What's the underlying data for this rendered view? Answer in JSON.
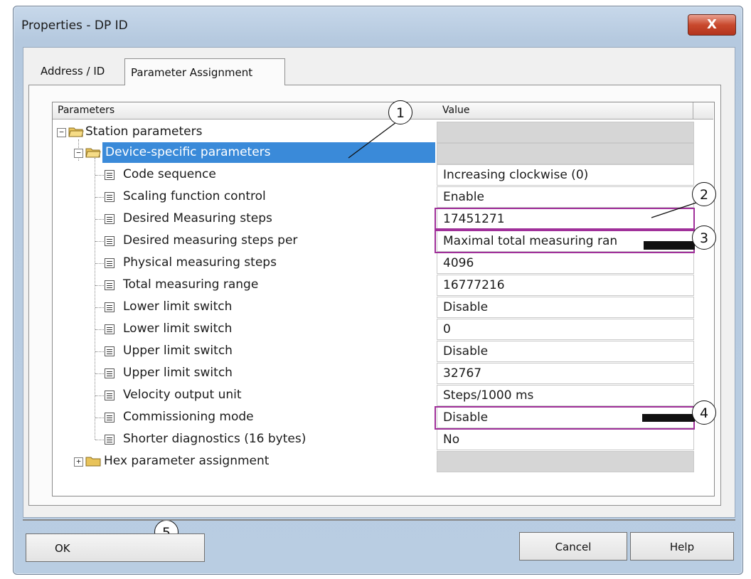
{
  "window": {
    "title": "Properties - DP ID",
    "close_glyph": "X"
  },
  "tabs": [
    {
      "label": "Address / ID"
    },
    {
      "label": "Parameter Assignment"
    }
  ],
  "grid": {
    "headers": {
      "parameters": "Parameters",
      "value": "Value"
    },
    "rows": [
      {
        "name": "Station parameters",
        "value": ""
      },
      {
        "name": "Device-specific parameters",
        "value": ""
      },
      {
        "name": "Code sequence",
        "value": "Increasing clockwise (0)"
      },
      {
        "name": "Scaling function control",
        "value": "Enable"
      },
      {
        "name": "Desired Measuring steps",
        "value": "17451271"
      },
      {
        "name": "Desired measuring steps per",
        "value": "Maximal total measuring ran"
      },
      {
        "name": "Physical measuring steps",
        "value": "4096"
      },
      {
        "name": "Total measuring range",
        "value": "16777216"
      },
      {
        "name": "Lower limit switch",
        "value": "Disable"
      },
      {
        "name": "Lower limit switch",
        "value": "0"
      },
      {
        "name": "Upper limit switch",
        "value": "Disable"
      },
      {
        "name": "Upper limit switch",
        "value": "32767"
      },
      {
        "name": "Velocity output unit",
        "value": "Steps/1000 ms"
      },
      {
        "name": "Commissioning mode",
        "value": "Disable"
      },
      {
        "name": "Shorter diagnostics (16 bytes)",
        "value": "No"
      },
      {
        "name": "Hex parameter assignment",
        "value": ""
      }
    ]
  },
  "callouts": [
    "1",
    "2",
    "3",
    "4",
    "5"
  ],
  "buttons": {
    "ok": "OK",
    "cancel": "Cancel",
    "help": "Help"
  },
  "icons": {
    "expanded": "−",
    "collapsed": "+",
    "folder": "folder-icon",
    "parameter": "parameter-icon"
  },
  "colors": {
    "selection": "#3a8ad9",
    "highlight_box": "#a0309a",
    "close_button": "#c9492d"
  }
}
